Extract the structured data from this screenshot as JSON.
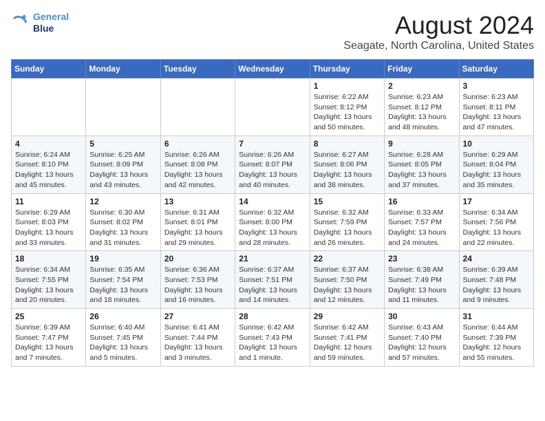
{
  "logo": {
    "line1": "General",
    "line2": "Blue"
  },
  "title": "August 2024",
  "subtitle": "Seagate, North Carolina, United States",
  "days_of_week": [
    "Sunday",
    "Monday",
    "Tuesday",
    "Wednesday",
    "Thursday",
    "Friday",
    "Saturday"
  ],
  "weeks": [
    [
      {
        "day": "",
        "info": ""
      },
      {
        "day": "",
        "info": ""
      },
      {
        "day": "",
        "info": ""
      },
      {
        "day": "",
        "info": ""
      },
      {
        "day": "1",
        "info": "Sunrise: 6:22 AM\nSunset: 8:12 PM\nDaylight: 13 hours\nand 50 minutes."
      },
      {
        "day": "2",
        "info": "Sunrise: 6:23 AM\nSunset: 8:12 PM\nDaylight: 13 hours\nand 48 minutes."
      },
      {
        "day": "3",
        "info": "Sunrise: 6:23 AM\nSunset: 8:11 PM\nDaylight: 13 hours\nand 47 minutes."
      }
    ],
    [
      {
        "day": "4",
        "info": "Sunrise: 6:24 AM\nSunset: 8:10 PM\nDaylight: 13 hours\nand 45 minutes."
      },
      {
        "day": "5",
        "info": "Sunrise: 6:25 AM\nSunset: 8:09 PM\nDaylight: 13 hours\nand 43 minutes."
      },
      {
        "day": "6",
        "info": "Sunrise: 6:26 AM\nSunset: 8:08 PM\nDaylight: 13 hours\nand 42 minutes."
      },
      {
        "day": "7",
        "info": "Sunrise: 6:26 AM\nSunset: 8:07 PM\nDaylight: 13 hours\nand 40 minutes."
      },
      {
        "day": "8",
        "info": "Sunrise: 6:27 AM\nSunset: 8:06 PM\nDaylight: 13 hours\nand 38 minutes."
      },
      {
        "day": "9",
        "info": "Sunrise: 6:28 AM\nSunset: 8:05 PM\nDaylight: 13 hours\nand 37 minutes."
      },
      {
        "day": "10",
        "info": "Sunrise: 6:29 AM\nSunset: 8:04 PM\nDaylight: 13 hours\nand 35 minutes."
      }
    ],
    [
      {
        "day": "11",
        "info": "Sunrise: 6:29 AM\nSunset: 8:03 PM\nDaylight: 13 hours\nand 33 minutes."
      },
      {
        "day": "12",
        "info": "Sunrise: 6:30 AM\nSunset: 8:02 PM\nDaylight: 13 hours\nand 31 minutes."
      },
      {
        "day": "13",
        "info": "Sunrise: 6:31 AM\nSunset: 8:01 PM\nDaylight: 13 hours\nand 29 minutes."
      },
      {
        "day": "14",
        "info": "Sunrise: 6:32 AM\nSunset: 8:00 PM\nDaylight: 13 hours\nand 28 minutes."
      },
      {
        "day": "15",
        "info": "Sunrise: 6:32 AM\nSunset: 7:59 PM\nDaylight: 13 hours\nand 26 minutes."
      },
      {
        "day": "16",
        "info": "Sunrise: 6:33 AM\nSunset: 7:57 PM\nDaylight: 13 hours\nand 24 minutes."
      },
      {
        "day": "17",
        "info": "Sunrise: 6:34 AM\nSunset: 7:56 PM\nDaylight: 13 hours\nand 22 minutes."
      }
    ],
    [
      {
        "day": "18",
        "info": "Sunrise: 6:34 AM\nSunset: 7:55 PM\nDaylight: 13 hours\nand 20 minutes."
      },
      {
        "day": "19",
        "info": "Sunrise: 6:35 AM\nSunset: 7:54 PM\nDaylight: 13 hours\nand 18 minutes."
      },
      {
        "day": "20",
        "info": "Sunrise: 6:36 AM\nSunset: 7:53 PM\nDaylight: 13 hours\nand 16 minutes."
      },
      {
        "day": "21",
        "info": "Sunrise: 6:37 AM\nSunset: 7:51 PM\nDaylight: 13 hours\nand 14 minutes."
      },
      {
        "day": "22",
        "info": "Sunrise: 6:37 AM\nSunset: 7:50 PM\nDaylight: 13 hours\nand 12 minutes."
      },
      {
        "day": "23",
        "info": "Sunrise: 6:38 AM\nSunset: 7:49 PM\nDaylight: 13 hours\nand 11 minutes."
      },
      {
        "day": "24",
        "info": "Sunrise: 6:39 AM\nSunset: 7:48 PM\nDaylight: 13 hours\nand 9 minutes."
      }
    ],
    [
      {
        "day": "25",
        "info": "Sunrise: 6:39 AM\nSunset: 7:47 PM\nDaylight: 13 hours\nand 7 minutes."
      },
      {
        "day": "26",
        "info": "Sunrise: 6:40 AM\nSunset: 7:45 PM\nDaylight: 13 hours\nand 5 minutes."
      },
      {
        "day": "27",
        "info": "Sunrise: 6:41 AM\nSunset: 7:44 PM\nDaylight: 13 hours\nand 3 minutes."
      },
      {
        "day": "28",
        "info": "Sunrise: 6:42 AM\nSunset: 7:43 PM\nDaylight: 13 hours\nand 1 minute."
      },
      {
        "day": "29",
        "info": "Sunrise: 6:42 AM\nSunset: 7:41 PM\nDaylight: 12 hours\nand 59 minutes."
      },
      {
        "day": "30",
        "info": "Sunrise: 6:43 AM\nSunset: 7:40 PM\nDaylight: 12 hours\nand 57 minutes."
      },
      {
        "day": "31",
        "info": "Sunrise: 6:44 AM\nSunset: 7:39 PM\nDaylight: 12 hours\nand 55 minutes."
      }
    ]
  ]
}
